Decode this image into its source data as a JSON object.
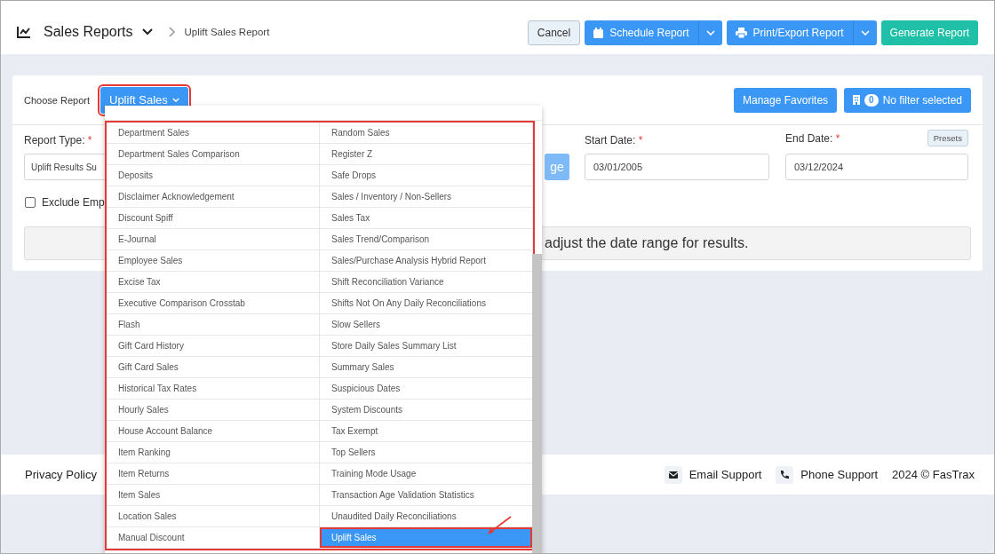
{
  "header": {
    "title": "Sales Reports",
    "breadcrumb": "Uplift Sales Report",
    "buttons": [
      {
        "label": "Cancel",
        "kind": "secondary"
      },
      {
        "label": "Schedule Report",
        "kind": "split"
      },
      {
        "label": "Print/Export Report",
        "kind": "split"
      },
      {
        "label": "Generate Report",
        "kind": "success"
      }
    ]
  },
  "choose_report": {
    "label": "Choose Report",
    "value": "Uplift Sales",
    "expanded": true
  },
  "favorites_button": "Manage Favorites",
  "filter": {
    "count": "0",
    "label": "No filter selected"
  },
  "form": {
    "report_type": {
      "label": "Report Type:",
      "required_mark": "*",
      "value": "Uplift Results Su"
    },
    "range_button": "ge",
    "start_date": {
      "label": "Start Date:",
      "required_mark": "*",
      "value": "03/01/2005"
    },
    "end_date": {
      "label": "End Date:",
      "required_mark": "*",
      "value": "03/12/2024"
    },
    "presets": "Presets",
    "exclude": {
      "label": "Exclude Emp",
      "checked": false
    },
    "notice": "adjust the date range for results."
  },
  "menu": {
    "columns": [
      [
        {
          "label": "Department Sales",
          "selected": false
        },
        {
          "label": "Department Sales Comparison",
          "selected": false
        },
        {
          "label": "Deposits",
          "selected": false
        },
        {
          "label": "Disclaimer Acknowledgement",
          "selected": false
        },
        {
          "label": "Discount Spiff",
          "selected": false
        },
        {
          "label": "E-Journal",
          "selected": false
        },
        {
          "label": "Employee Sales",
          "selected": false
        },
        {
          "label": "Excise Tax",
          "selected": false
        },
        {
          "label": "Executive Comparison Crosstab",
          "selected": false
        },
        {
          "label": "Flash",
          "selected": false
        },
        {
          "label": "Gift Card History",
          "selected": false
        },
        {
          "label": "Gift Card Sales",
          "selected": false
        },
        {
          "label": "Historical Tax Rates",
          "selected": false
        },
        {
          "label": "Hourly Sales",
          "selected": false
        },
        {
          "label": "House Account Balance",
          "selected": false
        },
        {
          "label": "Item Ranking",
          "selected": false
        },
        {
          "label": "Item Returns",
          "selected": false
        },
        {
          "label": "Item Sales",
          "selected": false
        },
        {
          "label": "Location Sales",
          "selected": false
        },
        {
          "label": "Manual Discount",
          "selected": false
        }
      ],
      [
        {
          "label": "Random Sales",
          "selected": false
        },
        {
          "label": "Register Z",
          "selected": false
        },
        {
          "label": "Safe Drops",
          "selected": false
        },
        {
          "label": "Sales / Inventory / Non-Sellers",
          "selected": false
        },
        {
          "label": "Sales Tax",
          "selected": false
        },
        {
          "label": "Sales Trend/Comparison",
          "selected": false
        },
        {
          "label": "Sales/Purchase Analysis Hybrid Report",
          "selected": false
        },
        {
          "label": "Shift Reconciliation Variance",
          "selected": false
        },
        {
          "label": "Shifts Not On Any Daily Reconciliations",
          "selected": false
        },
        {
          "label": "Slow Sellers",
          "selected": false
        },
        {
          "label": "Store Daily Sales Summary List",
          "selected": false
        },
        {
          "label": "Summary Sales",
          "selected": false
        },
        {
          "label": "Suspicious Dates",
          "selected": false
        },
        {
          "label": "System Discounts",
          "selected": false
        },
        {
          "label": "Tax Exempt",
          "selected": false
        },
        {
          "label": "Top Sellers",
          "selected": false
        },
        {
          "label": "Training Mode Usage",
          "selected": false
        },
        {
          "label": "Transaction Age Validation Statistics",
          "selected": false
        },
        {
          "label": "Unaudited Daily Reconciliations",
          "selected": false
        },
        {
          "label": "Uplift Sales",
          "selected": true
        }
      ]
    ]
  },
  "footer": {
    "privacy": "Privacy Policy",
    "links": [
      "Email Support",
      "Phone Support"
    ],
    "copyright": "2024 © FasTrax"
  }
}
